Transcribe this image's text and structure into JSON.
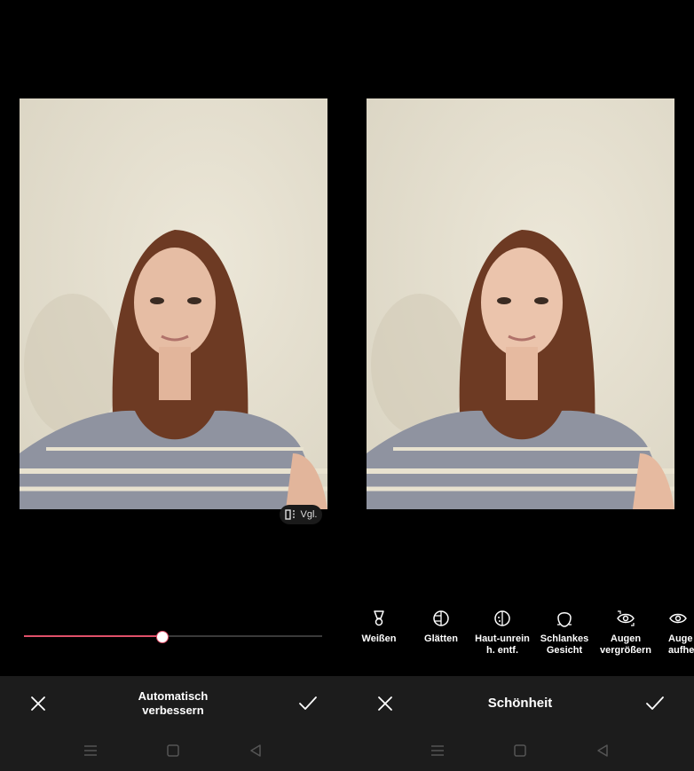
{
  "left": {
    "compare_label": "Vgl.",
    "compare_icon": "compare-icon",
    "slider_value": 0.46,
    "slider_color": "#e0506a",
    "title": "Automatisch verbessern",
    "cancel_icon": "close-icon",
    "confirm_icon": "check-icon"
  },
  "right": {
    "title": "Schönheit",
    "tools": [
      {
        "label": "Weißen",
        "icon": "lightbulb-icon"
      },
      {
        "label": "Glätten",
        "icon": "smooth-icon"
      },
      {
        "label": "Haut-unrein\nh. entf.",
        "icon": "blemish-icon"
      },
      {
        "label": "Schlankes\nGesicht",
        "icon": "face-slim-icon"
      },
      {
        "label": "Augen\nvergrößern",
        "icon": "eye-enlarge-icon"
      },
      {
        "label": "Auge\naufhel",
        "icon": "eye-brighten-icon"
      }
    ],
    "cancel_icon": "close-icon",
    "confirm_icon": "check-icon"
  },
  "nav": [
    "menu-icon",
    "home-icon",
    "back-icon"
  ]
}
